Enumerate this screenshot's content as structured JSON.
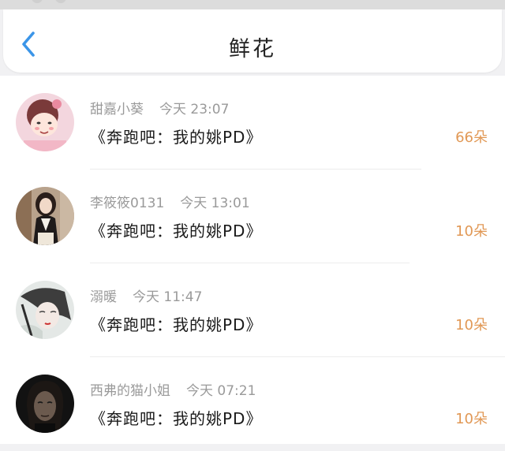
{
  "header": {
    "title": "鲜花",
    "back_icon": "chevron-left-icon",
    "accent": "#3b95e8"
  },
  "colors": {
    "count": "#e19855",
    "meta": "#9a9a9a"
  },
  "items": [
    {
      "user": "甜嘉小葵",
      "time": "今天 23:07",
      "work": "《奔跑吧：我的姚PD》",
      "count": "66朵",
      "avatar": "avatar-cartoon-girl"
    },
    {
      "user": "李筱筱0131",
      "time": "今天 13:01",
      "work": "《奔跑吧：我的姚PD》",
      "count": "10朵",
      "avatar": "avatar-woman-dark-hair"
    },
    {
      "user": "溺暖",
      "time": "今天 11:47",
      "work": "《奔跑吧：我的姚PD》",
      "count": "10朵",
      "avatar": "avatar-girl-sketch"
    },
    {
      "user": "西弗的猫小姐",
      "time": "今天 07:21",
      "work": "《奔跑吧：我的姚PD》",
      "count": "10朵",
      "avatar": "avatar-dark-portrait"
    }
  ]
}
